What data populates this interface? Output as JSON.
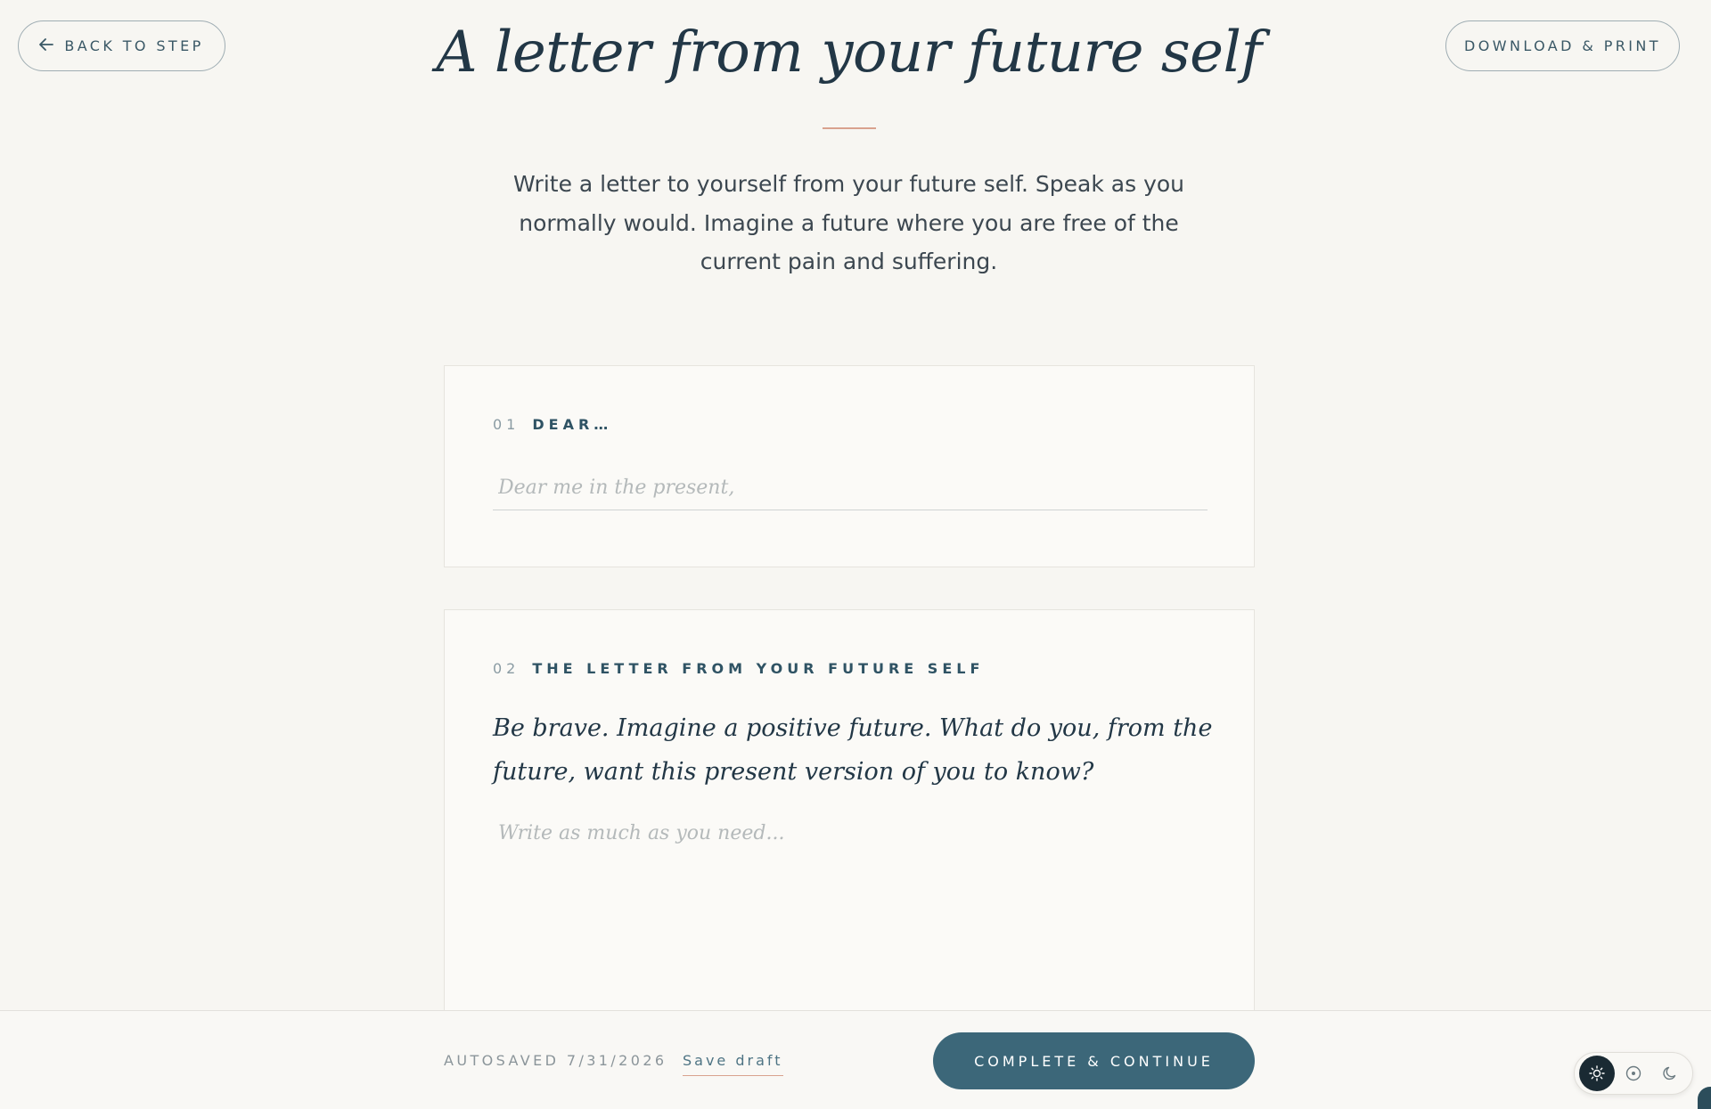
{
  "header": {
    "back_label": "BACK TO STEP",
    "back_icon": "arrow-left-icon",
    "print_label": "DOWNLOAD & PRINT",
    "title": "A letter from your future self",
    "intro": "Write a letter to yourself from your future self. Speak as you normally would. Imagine a future where you are free of the current pain and suffering."
  },
  "sections": [
    {
      "number": "01",
      "label": "DEAR…",
      "input_value": "",
      "placeholder": "Dear me in the present,"
    },
    {
      "number": "02",
      "label": "THE LETTER FROM YOUR FUTURE SELF",
      "prompt": "Be brave. Imagine a positive future. What do you, from the future, want this present version of you to know?",
      "input_value": "",
      "placeholder": "Write as much as you need..."
    }
  ],
  "footer": {
    "autosaved": "AUTOSAVED 7/31/2026",
    "save_draft": "Save draft",
    "complete_label": "COMPLETE & CONTINUE"
  },
  "theme_toggle": {
    "options": [
      "sun-icon",
      "system-icon",
      "moon-icon"
    ],
    "selected": "sun-icon"
  },
  "colors": {
    "accent": "#3c6779",
    "rule": "#d9a28e",
    "background": "#f7f6f2"
  }
}
